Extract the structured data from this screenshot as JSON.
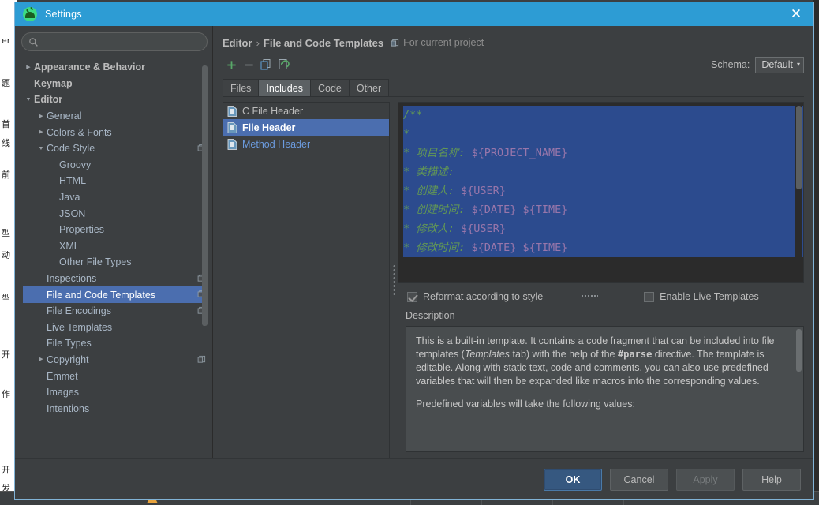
{
  "window": {
    "title": "Settings",
    "app_icon": "android-studio-icon",
    "close_icon": "close-icon",
    "accent_titlebar": "#2d9cd4"
  },
  "search": {
    "placeholder": "",
    "value": "",
    "icon": "search-icon"
  },
  "sidebar": {
    "scrollbar": "vertical-scrollbar",
    "items": [
      {
        "label": "Appearance & Behavior",
        "indent": 0,
        "arrow": "▶",
        "bold": true,
        "selected": false,
        "badge": false
      },
      {
        "label": "Keymap",
        "indent": 0,
        "arrow": "",
        "bold": true,
        "selected": false,
        "badge": false
      },
      {
        "label": "Editor",
        "indent": 0,
        "arrow": "▼",
        "bold": true,
        "selected": false,
        "badge": false
      },
      {
        "label": "General",
        "indent": 1,
        "arrow": "▶",
        "bold": false,
        "selected": false,
        "badge": false
      },
      {
        "label": "Colors & Fonts",
        "indent": 1,
        "arrow": "▶",
        "bold": false,
        "selected": false,
        "badge": false
      },
      {
        "label": "Code Style",
        "indent": 1,
        "arrow": "▼",
        "bold": false,
        "selected": false,
        "badge": true
      },
      {
        "label": "Groovy",
        "indent": 2,
        "arrow": "",
        "bold": false,
        "selected": false,
        "badge": false
      },
      {
        "label": "HTML",
        "indent": 2,
        "arrow": "",
        "bold": false,
        "selected": false,
        "badge": false
      },
      {
        "label": "Java",
        "indent": 2,
        "arrow": "",
        "bold": false,
        "selected": false,
        "badge": false
      },
      {
        "label": "JSON",
        "indent": 2,
        "arrow": "",
        "bold": false,
        "selected": false,
        "badge": false
      },
      {
        "label": "Properties",
        "indent": 2,
        "arrow": "",
        "bold": false,
        "selected": false,
        "badge": false
      },
      {
        "label": "XML",
        "indent": 2,
        "arrow": "",
        "bold": false,
        "selected": false,
        "badge": false
      },
      {
        "label": "Other File Types",
        "indent": 2,
        "arrow": "",
        "bold": false,
        "selected": false,
        "badge": false
      },
      {
        "label": "Inspections",
        "indent": 1,
        "arrow": "",
        "bold": false,
        "selected": false,
        "badge": true
      },
      {
        "label": "File and Code Templates",
        "indent": 1,
        "arrow": "",
        "bold": false,
        "selected": true,
        "badge": true
      },
      {
        "label": "File Encodings",
        "indent": 1,
        "arrow": "",
        "bold": false,
        "selected": false,
        "badge": true
      },
      {
        "label": "Live Templates",
        "indent": 1,
        "arrow": "",
        "bold": false,
        "selected": false,
        "badge": false
      },
      {
        "label": "File Types",
        "indent": 1,
        "arrow": "",
        "bold": false,
        "selected": false,
        "badge": false
      },
      {
        "label": "Copyright",
        "indent": 1,
        "arrow": "▶",
        "bold": false,
        "selected": false,
        "badge": true
      },
      {
        "label": "Emmet",
        "indent": 1,
        "arrow": "",
        "bold": false,
        "selected": false,
        "badge": false
      },
      {
        "label": "Images",
        "indent": 1,
        "arrow": "",
        "bold": false,
        "selected": false,
        "badge": false
      },
      {
        "label": "Intentions",
        "indent": 1,
        "arrow": "",
        "bold": false,
        "selected": false,
        "badge": false
      }
    ]
  },
  "breadcrumb": {
    "root": "Editor",
    "separator": "›",
    "leaf": "File and Code Templates",
    "scope_badge": "project-scope-icon",
    "scope_note": "For current project"
  },
  "toolbar": {
    "add_label": "+",
    "add_icon": "add-icon",
    "remove_label": "−",
    "remove_icon": "remove-icon",
    "copy_icon": "copy-template-icon",
    "reset_icon": "reset-template-icon"
  },
  "schema": {
    "label": "Schema:",
    "value": "Default",
    "arrow": "▾",
    "options": [
      "Default"
    ]
  },
  "tabs": [
    {
      "label": "Files",
      "active": false
    },
    {
      "label": "Includes",
      "active": true
    },
    {
      "label": "Code",
      "active": false
    },
    {
      "label": "Other",
      "active": false
    }
  ],
  "template_list": [
    {
      "label": "C File Header",
      "icon": "file-template-icon",
      "selected": false,
      "modified": false
    },
    {
      "label": "File Header",
      "icon": "file-template-icon",
      "selected": true,
      "modified": false
    },
    {
      "label": "Method Header",
      "icon": "file-template-icon",
      "selected": false,
      "modified": true
    }
  ],
  "editor": {
    "all_selected": true,
    "selection_color": "#2c4b8e",
    "comment_color": "#629755",
    "variable_color": "#9876aa",
    "lines": [
      [
        {
          "t": "/**",
          "k": "cm"
        }
      ],
      [
        {
          "t": "*",
          "k": "cm"
        }
      ],
      [
        {
          "t": "* 项目名称: ",
          "k": "cm"
        },
        {
          "t": "${PROJECT_NAME}",
          "k": "var"
        }
      ],
      [
        {
          "t": "* 类描述:",
          "k": "cm"
        }
      ],
      [
        {
          "t": "* 创建人: ",
          "k": "cm"
        },
        {
          "t": "${USER}",
          "k": "var"
        }
      ],
      [
        {
          "t": "* 创建时间: ",
          "k": "cm"
        },
        {
          "t": "${DATE} ${TIME}",
          "k": "var"
        }
      ],
      [
        {
          "t": "* 修改人: ",
          "k": "cm"
        },
        {
          "t": "${USER}",
          "k": "var"
        }
      ],
      [
        {
          "t": "* 修改时间: ",
          "k": "cm"
        },
        {
          "t": "${DATE} ${TIME}",
          "k": "var"
        }
      ]
    ]
  },
  "options": {
    "reformat": {
      "label_pre": "",
      "mnemonic": "R",
      "label_post": "eformat according to style",
      "checked": true
    },
    "live_templates": {
      "label_pre": "Enable ",
      "mnemonic": "L",
      "label_post": "ive Templates",
      "checked": false
    }
  },
  "description": {
    "title": "Description",
    "para1_a": "This is a built-in template. It contains a code fragment that can be included into file templates (",
    "para1_italic": "Templates",
    "para1_b": " tab) with the help of the ",
    "para1_bold": "#parse",
    "para1_c": " directive. The template is editable. Along with static text, code and comments, you can also use predefined variables that will then be expanded like macros into the corresponding values.",
    "para2": "Predefined variables will take the following values:"
  },
  "footer": {
    "ok": "OK",
    "cancel": "Cancel",
    "apply": "Apply",
    "help": "Help",
    "apply_disabled": true,
    "ok_color": "#365880"
  }
}
